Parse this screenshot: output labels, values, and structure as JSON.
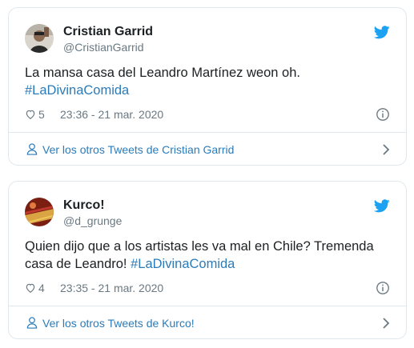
{
  "tweets": [
    {
      "name": "Cristian Garrid",
      "handle": "@CristianGarrid",
      "text_main": "La mansa casa del Leandro Martínez weon oh.",
      "hashtag": "#LaDivinaComida",
      "likes": "5",
      "time": "23:36 - 21 mar. 2020",
      "footer": "Ver los otros Tweets de Cristian Garrid"
    },
    {
      "name": "Kurco!",
      "handle": "@d_grunge",
      "text_main": "Quien dijo que a los artistas les va mal en Chile? Tremenda casa de Leandro!",
      "hashtag": "#LaDivinaComida",
      "likes": "4",
      "time": "23:35 - 21 mar. 2020",
      "footer": "Ver los otros Tweets de Kurco!"
    }
  ],
  "colors": {
    "link": "#2b7bb9",
    "twitter_blue": "#1da1f2",
    "secondary_text": "#697882",
    "border": "#e1e8ed"
  },
  "icons": [
    "twitter-bird-icon",
    "heart-icon",
    "info-icon",
    "user-icon",
    "chevron-right-icon"
  ]
}
